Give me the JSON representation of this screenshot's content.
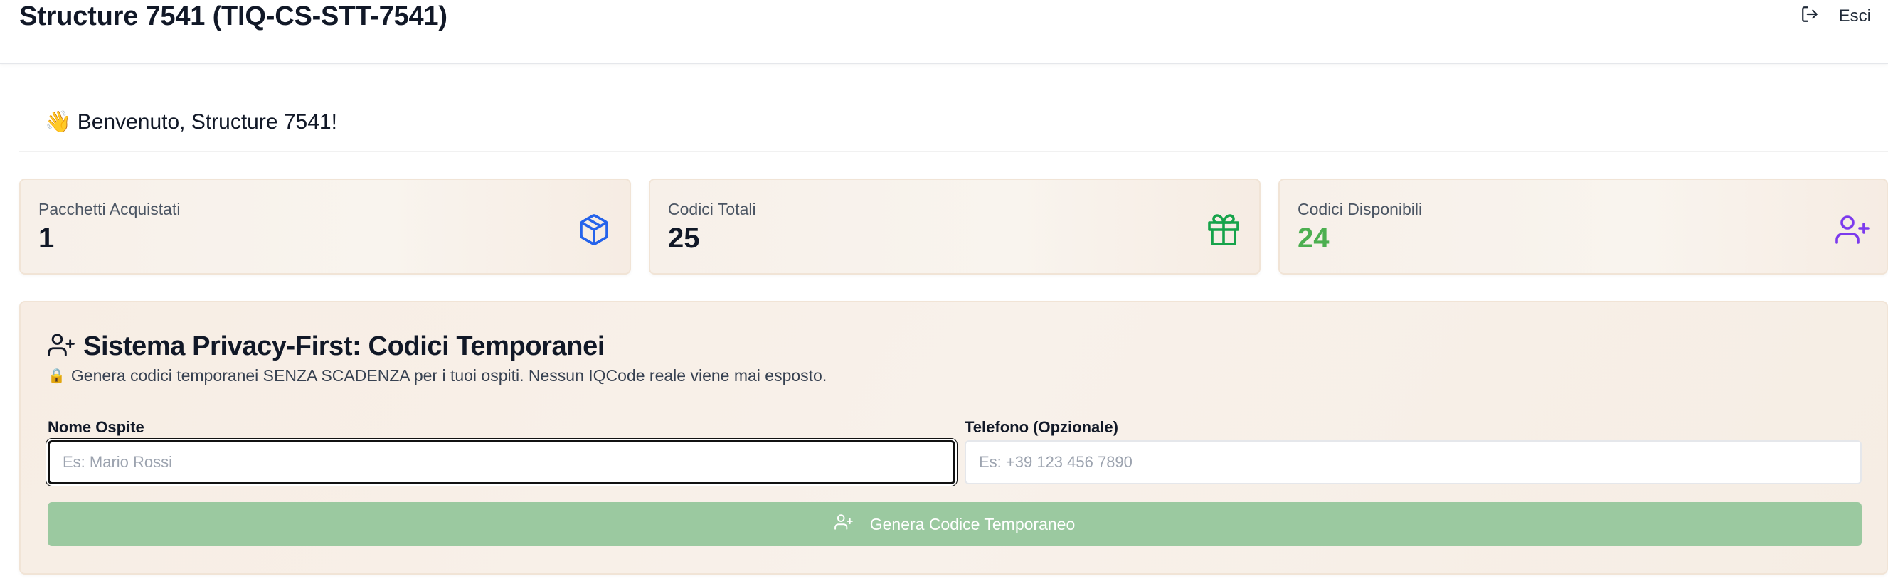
{
  "header": {
    "title": "Structure 7541 (TIQ-CS-STT-7541)",
    "logout_label": "Esci"
  },
  "welcome": {
    "emoji": "👋",
    "text": "Benvenuto, Structure 7541!"
  },
  "stats": [
    {
      "label": "Pacchetti Acquistati",
      "value": "1",
      "icon": "package-icon",
      "icon_color": "#2563eb",
      "value_color": "#111827"
    },
    {
      "label": "Codici Totali",
      "value": "25",
      "icon": "gift-icon",
      "icon_color": "#16a34a",
      "value_color": "#111827"
    },
    {
      "label": "Codici Disponibili",
      "value": "24",
      "icon": "user-plus-icon",
      "icon_color": "#7c3aed",
      "value_color": "#4caf50"
    }
  ],
  "panel": {
    "title": "Sistema Privacy-First: Codici Temporanei",
    "subtitle_icon": "🔒",
    "subtitle": "Genera codici temporanei SENZA SCADENZA per i tuoi ospiti. Nessun IQCode reale viene mai esposto.",
    "guest_name": {
      "label": "Nome Ospite",
      "placeholder": "Es: Mario Rossi",
      "value": ""
    },
    "phone": {
      "label": "Telefono (Opzionale)",
      "placeholder": "Es: +39 123 456 7890",
      "value": ""
    },
    "generate_label": "Genera Codice Temporaneo"
  },
  "colors": {
    "button_bg": "#9bc9a0",
    "card_bg": "#f7f0e9",
    "available_green": "#4caf50"
  }
}
